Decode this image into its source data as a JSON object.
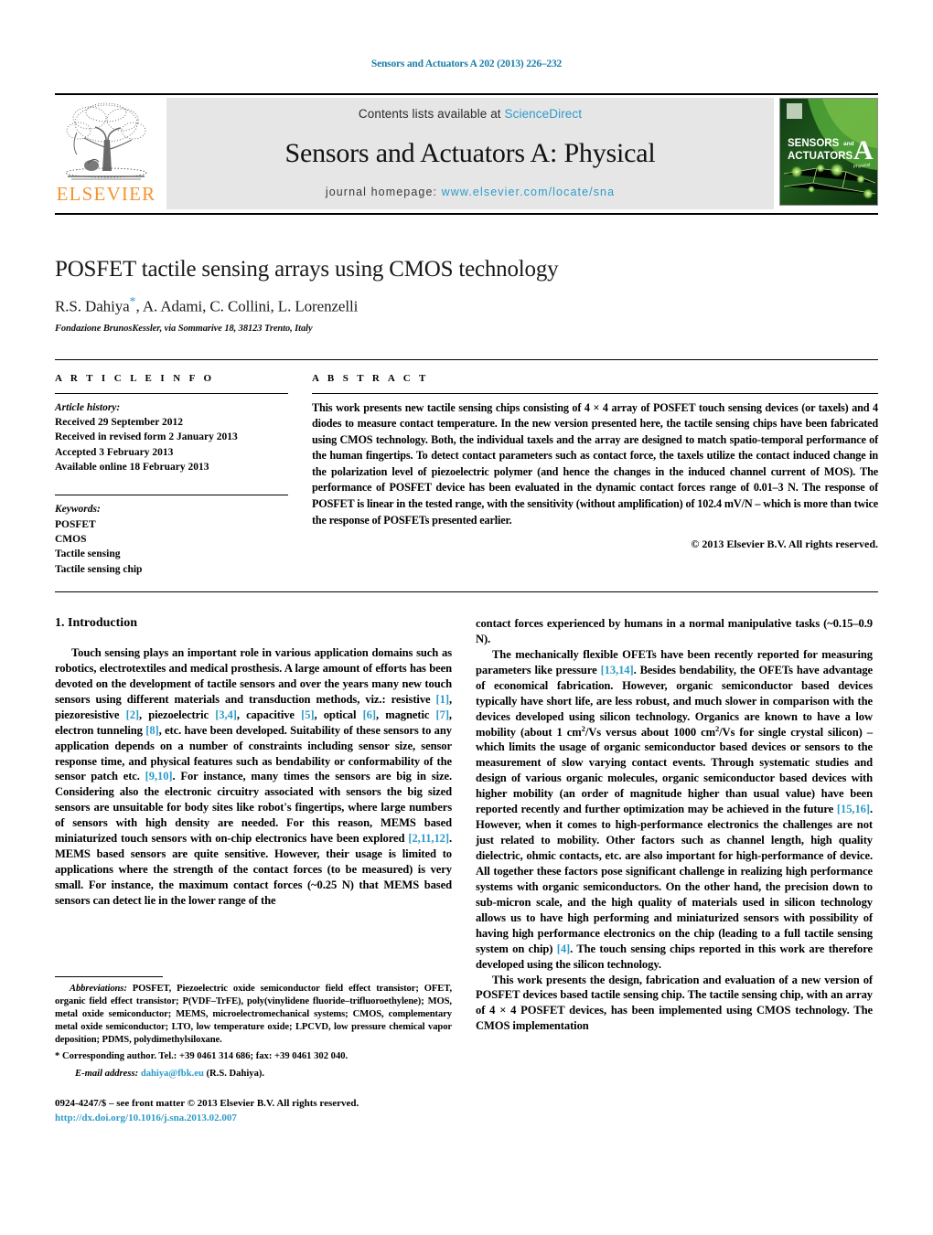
{
  "running_head": "Sensors and Actuators A 202 (2013) 226–232",
  "masthead": {
    "publisher_name": "ELSEVIER",
    "contents_prefix": "Contents lists available at ",
    "contents_link": "ScienceDirect",
    "journal_title": "Sensors and Actuators A: Physical",
    "homepage_prefix": "journal homepage: ",
    "homepage_url": "www.elsevier.com/locate/sna",
    "cover": {
      "line1": "SENSORS",
      "line1_and": "and",
      "line2": "ACTUATORS",
      "big_letter": "A",
      "sub_letter": "Physical"
    },
    "accent_link_color": "#2e9bc9",
    "elsevier_orange": "#f59331"
  },
  "title_block": {
    "title": "POSFET tactile sensing arrays using CMOS technology",
    "authors": "R.S. Dahiya",
    "authors_rest": ", A. Adami, C. Collini, L. Lorenzelli",
    "corresponding_marker": "*",
    "affiliation": "Fondazione BrunosKessler, via Sommarive 18, 38123 Trento, Italy"
  },
  "article_info": {
    "heading": "A R T I C L E    I N F O",
    "history_label": "Article history:",
    "history": [
      "Received 29 September 2012",
      "Received in revised form 2 January 2013",
      "Accepted 3 February 2013",
      "Available online 18 February 2013"
    ],
    "keywords_label": "Keywords:",
    "keywords": [
      "POSFET",
      "CMOS",
      "Tactile sensing",
      "Tactile sensing chip"
    ]
  },
  "abstract": {
    "heading": "A B S T R A C T",
    "text": "This work presents new tactile sensing chips consisting of 4 × 4 array of POSFET touch sensing devices (or taxels) and 4 diodes to measure contact temperature. In the new version presented here, the tactile sensing chips have been fabricated using CMOS technology. Both, the individual taxels and the array are designed to match spatio-temporal performance of the human fingertips. To detect contact parameters such as contact force, the taxels utilize the contact induced change in the polarization level of piezoelectric polymer (and hence the changes in the induced channel current of MOS). The performance of POSFET device has been evaluated in the dynamic contact forces range of 0.01–3 N. The response of POSFET is linear in the tested range, with the sensitivity (without amplification) of 102.4 mV/N – which is more than twice the response of POSFETs presented earlier.",
    "copyright": "© 2013 Elsevier B.V. All rights reserved."
  },
  "body": {
    "section_number_title": "1.  Introduction",
    "left_paragraph_1_a": "Touch sensing plays an important role in various application domains such as robotics, electrotextiles and medical prosthesis. A large amount of efforts has been devoted on the development of tactile sensors and over the years many new touch sensors using different materials and transduction methods, viz.: resistive ",
    "left_ref_1": "[1]",
    "left_paragraph_1_b": ", piezoresistive ",
    "left_ref_2": "[2]",
    "left_paragraph_1_c": ", piezoelectric ",
    "left_ref_34": "[3,4]",
    "left_paragraph_1_d": ", capacitive ",
    "left_ref_5": "[5]",
    "left_paragraph_1_e": ", optical ",
    "left_ref_6": "[6]",
    "left_paragraph_1_f": ", magnetic ",
    "left_ref_7": "[7]",
    "left_paragraph_1_g": ", electron tunneling ",
    "left_ref_8": "[8]",
    "left_paragraph_1_h": ", etc. have been developed. Suitability of these sensors to any application depends on a number of constraints including sensor size, sensor response time, and physical features such as bendability or conformability of the sensor patch etc. ",
    "left_ref_910": "[9,10]",
    "left_paragraph_1_i": ". For instance, many times the sensors are big in size. Considering also the electronic circuitry associated with sensors the big sized sensors are unsuitable for body sites like robot's fingertips, where large numbers of sensors with high density are needed. For this reason, MEMS based miniaturized touch sensors with on-chip electronics have been explored ",
    "left_ref_21112": "[2,11,12]",
    "left_paragraph_1_j": ". MEMS based sensors are quite sensitive. However, their usage is limited to applications where the strength of the contact forces (to be measured) is very small. For instance, the maximum contact forces (~0.25 N) that MEMS based sensors can detect lie in the lower range of the",
    "right_paragraph_continued": "contact forces experienced by humans in a normal manipulative tasks (~0.15–0.9 N).",
    "right_paragraph_2_a": "The mechanically flexible OFETs have been recently reported for measuring parameters like pressure ",
    "right_ref_1314": "[13,14]",
    "right_paragraph_2_b": ". Besides bendability, the OFETs have advantage of economical fabrication. However, organic semiconductor based devices typically have short life, are less robust, and much slower in comparison with the devices developed using silicon technology. Organics are known to have a low mobility (about 1 cm",
    "sup_2": "2",
    "right_paragraph_2_c": "/Vs versus about 1000  cm",
    "right_paragraph_2_d": "/Vs for single crystal silicon) – which limits the usage of organic semiconductor based devices or sensors to the measurement of slow varying contact events. Through systematic studies and design of various organic molecules, organic semiconductor based devices with higher mobility (an order of magnitude higher than usual value) have been reported recently and further optimization may be achieved in the future ",
    "right_ref_1516": "[15,16]",
    "right_paragraph_2_e": ". However, when it comes to high-performance electronics the challenges are not just related to mobility. Other factors such as channel length, high quality dielectric, ohmic contacts, etc. are also important for high-performance of device. All together these factors pose significant challenge in realizing high performance systems with organic semiconductors. On the other hand, the precision down to sub-micron scale, and the high quality of materials used in silicon technology allows us to have high performing and miniaturized sensors with possibility of having high performance electronics on the chip (leading to a full tactile sensing system on chip) ",
    "right_ref_4": "[4]",
    "right_paragraph_2_f": ". The touch sensing chips reported in this work are therefore developed using the silicon technology.",
    "right_paragraph_3": "This work presents the design, fabrication and evaluation of a new version of POSFET devices based tactile sensing chip. The tactile sensing chip, with an array of 4 × 4 POSFET devices, has been implemented using CMOS technology. The CMOS implementation"
  },
  "footnotes": {
    "abbrev_label": "Abbreviations:",
    "abbrev_text": "  POSFET, Piezoelectric oxide semiconductor field effect transistor; OFET, organic field effect transistor; P(VDF–TrFE), poly(vinylidene fluoride–trifluoroethylene); MOS, metal oxide semiconductor; MEMS, microelectromechanical systems; CMOS, complementary metal oxide semiconductor; LTO, low temperature oxide; LPCVD, low pressure chemical vapor deposition; PDMS, polydimethylsiloxane.",
    "corresponding_marker": "*",
    "corresponding_text": " Corresponding author. Tel.: +39 0461 314 686; fax: +39 0461 302 040.",
    "email_label": "E-mail address:",
    "email": "dahiya@fbk.eu",
    "email_owner": " (R.S. Dahiya).",
    "issn_line": "0924-4247/$ – see front matter © 2013 Elsevier B.V. All rights reserved.",
    "doi": "http://dx.doi.org/10.1016/j.sna.2013.02.007"
  }
}
